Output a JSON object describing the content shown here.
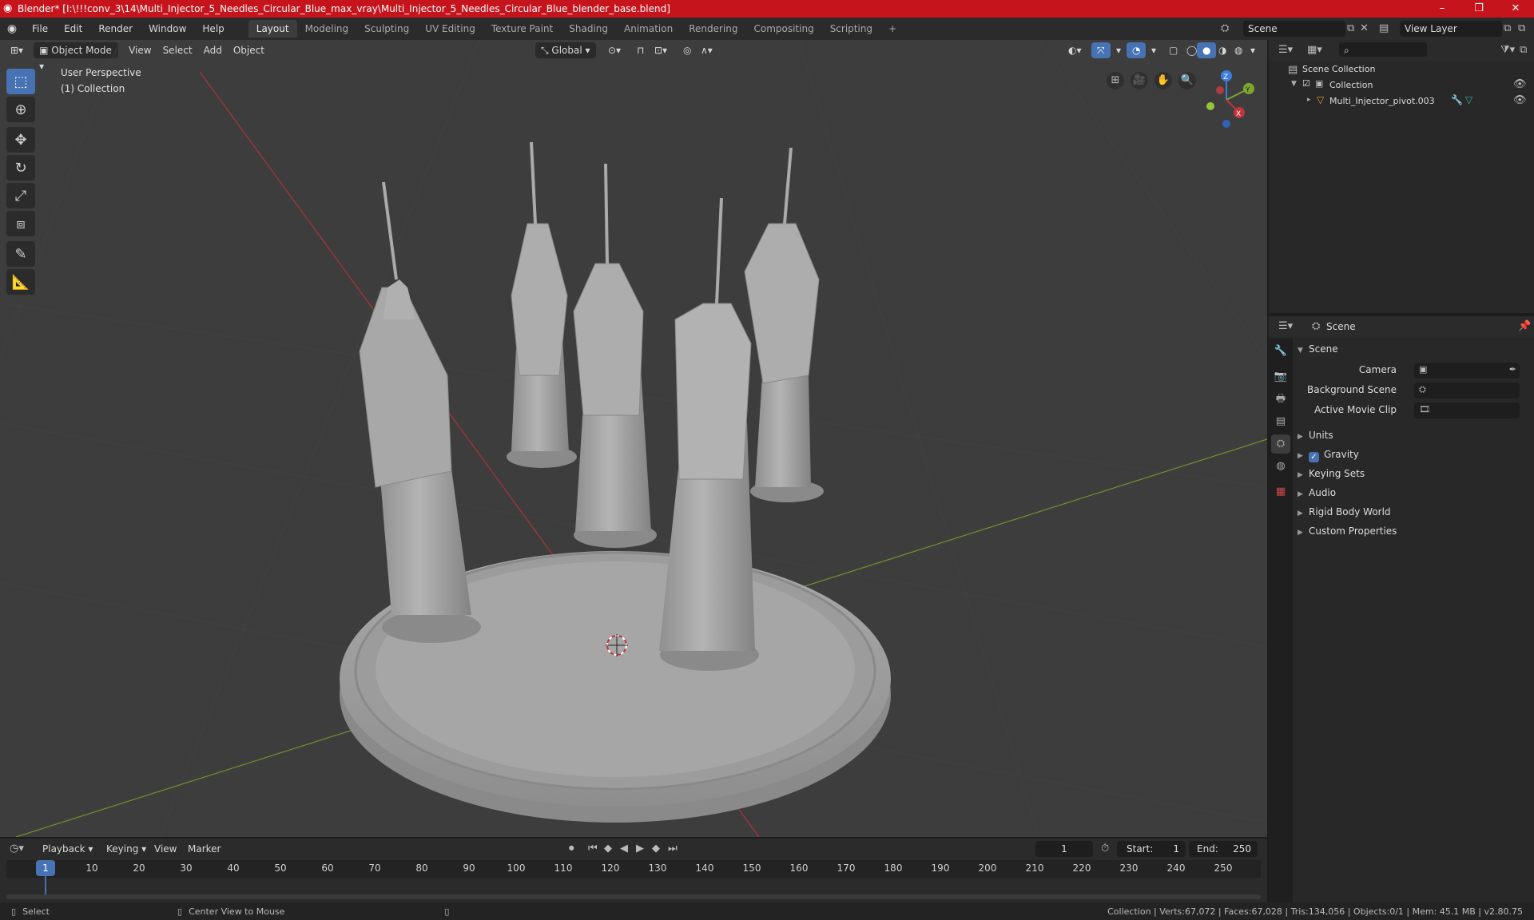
{
  "window": {
    "title": "Blender* [I:\\!!!conv_3\\14\\Multi_Injector_5_Needles_Circular_Blue_max_vray\\Multi_Injector_5_Needles_Circular_Blue_blender_base.blend]",
    "minimize": "–",
    "maximize": "❐",
    "close": "✕"
  },
  "menubar": {
    "items": [
      "File",
      "Edit",
      "Render",
      "Window",
      "Help"
    ],
    "workspaces": [
      "Layout",
      "Modeling",
      "Sculpting",
      "UV Editing",
      "Texture Paint",
      "Shading",
      "Animation",
      "Rendering",
      "Compositing",
      "Scripting"
    ],
    "active_workspace": "Layout",
    "add_tab": "+",
    "scene": "Scene",
    "view_layer": "View Layer"
  },
  "viewport": {
    "mode": "Object Mode",
    "menus": [
      "View",
      "Select",
      "Add",
      "Object"
    ],
    "orientation": "Global",
    "perspective_label": "User Perspective",
    "collection_label": "(1) Collection",
    "gizmo": {
      "x": "X",
      "y": "Y",
      "z": "Z"
    }
  },
  "outliner": {
    "root": "Scene Collection",
    "collection": "Collection",
    "object": "Multi_Injector_pivot.003"
  },
  "properties": {
    "context": "Scene",
    "panel": "Scene",
    "camera_label": "Camera",
    "background_scene_label": "Background Scene",
    "active_movie_clip_label": "Active Movie Clip",
    "sections": [
      "Units",
      "Gravity",
      "Keying Sets",
      "Audio",
      "Rigid Body World",
      "Custom Properties"
    ],
    "gravity_checked": true
  },
  "timeline": {
    "menus": [
      "Playback",
      "Keying",
      "View",
      "Marker"
    ],
    "current_frame": "1",
    "start_label": "Start:",
    "start": "1",
    "end_label": "End:",
    "end": "250",
    "ticks": [
      "1",
      "10",
      "20",
      "30",
      "40",
      "50",
      "60",
      "70",
      "80",
      "90",
      "100",
      "110",
      "120",
      "130",
      "140",
      "150",
      "160",
      "170",
      "180",
      "190",
      "200",
      "210",
      "220",
      "230",
      "240",
      "250"
    ]
  },
  "statusbar": {
    "select": "Select",
    "center_view": "Center View to Mouse",
    "stats": "Collection | Verts:67,072 | Faces:67,028 | Tris:134,056 | Objects:0/1 | Mem: 45.1 MB | v2.80.75"
  },
  "colors": {
    "titlebar": "#c6141d",
    "accent": "#4772b3",
    "viewport_bg": "#3d3d3d",
    "x_axis": "#c2333c",
    "y_axis": "#7ba82b",
    "z_axis": "#3d7ce0"
  }
}
